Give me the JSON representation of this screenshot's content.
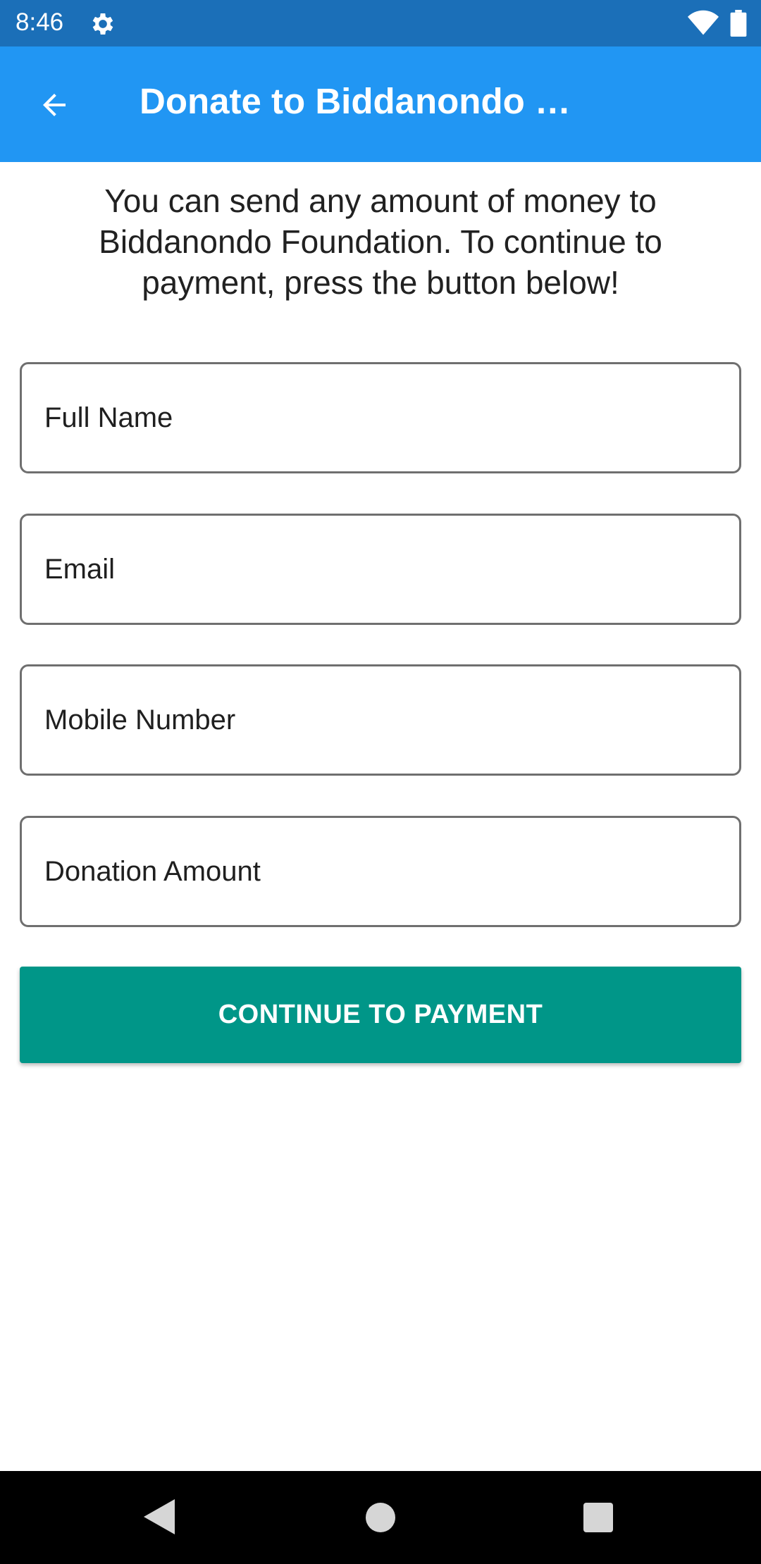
{
  "status_bar": {
    "time": "8:46",
    "icons": [
      "gear-icon",
      "wifi-icon",
      "battery-icon"
    ]
  },
  "app_bar": {
    "title": "Donate to Biddanondo …",
    "back_icon": "arrow-back-icon",
    "color": "#2196f3"
  },
  "intro_text": "You can send any amount of money to Biddanondo Foundation. To continue to payment, press the button below!",
  "form": {
    "fields": [
      {
        "label": "Full Name"
      },
      {
        "label": "Email"
      },
      {
        "label": "Mobile Number"
      },
      {
        "label": "Donation Amount"
      }
    ],
    "submit_label": "CONTINUE TO PAYMENT",
    "submit_color": "#009688"
  },
  "nav_bar": {
    "icons": [
      "nav-back-icon",
      "nav-home-icon",
      "nav-recents-icon"
    ]
  }
}
